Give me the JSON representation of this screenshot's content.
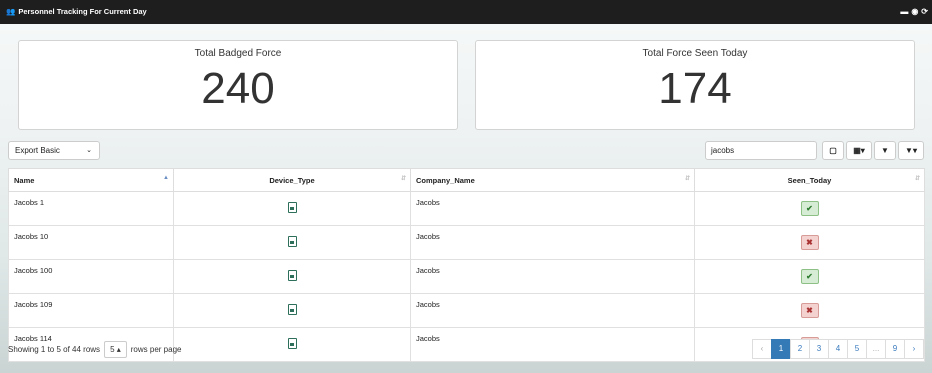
{
  "window": {
    "title": "Personnel Tracking For Current Day",
    "controls": [
      "minimize-icon",
      "eye-icon",
      "refresh-icon"
    ]
  },
  "cards": [
    {
      "label": "Total Badged Force",
      "value": "240"
    },
    {
      "label": "Total Force Seen Today",
      "value": "174"
    }
  ],
  "toolbar": {
    "export_value": "Export Basic",
    "search_value": "jacobs"
  },
  "table": {
    "columns": [
      "Name",
      "Device_Type",
      "Company_Name",
      "Seen_Today"
    ],
    "rows": [
      {
        "name": "Jacobs 1",
        "company": "Jacobs",
        "seen": true
      },
      {
        "name": "Jacobs 10",
        "company": "Jacobs",
        "seen": false
      },
      {
        "name": "Jacobs 100",
        "company": "Jacobs",
        "seen": true
      },
      {
        "name": "Jacobs 109",
        "company": "Jacobs",
        "seen": false
      },
      {
        "name": "Jacobs 114",
        "company": "Jacobs",
        "seen": false
      }
    ]
  },
  "footer": {
    "showing": "Showing 1 to 5 of 44 rows",
    "page_size": "5",
    "per_page": "rows per page"
  },
  "pagination": {
    "prev": "‹",
    "pages": [
      "1",
      "2",
      "3",
      "4",
      "5",
      "...",
      "9"
    ],
    "next": "›",
    "active": "1"
  },
  "colors": {
    "titlebar": "#1e1e1e",
    "seen_yes": "#d7ecd4",
    "seen_no": "#f3d2d0",
    "pager_active": "#337ab7"
  }
}
